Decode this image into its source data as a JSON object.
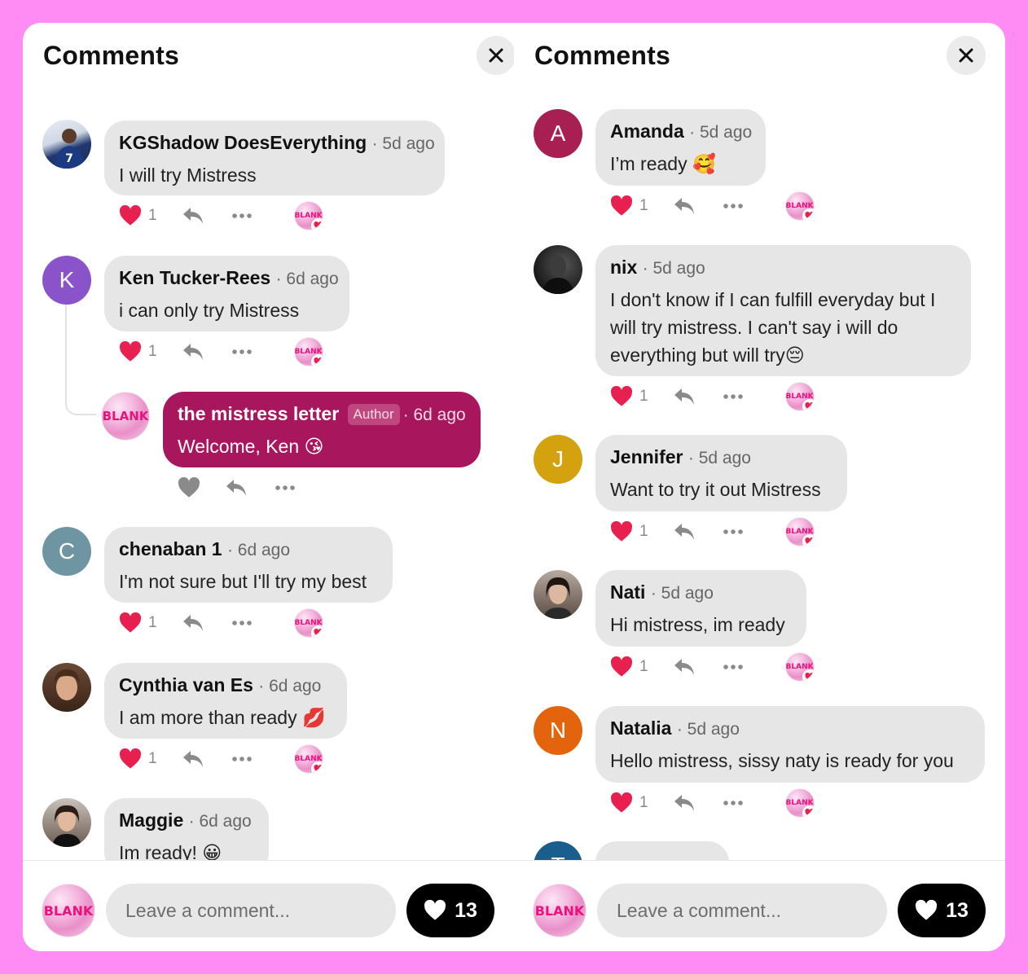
{
  "colors": {
    "background": "#ff8cf4",
    "like": "#e8204f",
    "author_bubble": "#a8175d",
    "avatar_K": "#8a53c9",
    "avatar_C": "#6f95a2",
    "avatar_A": "#a81f52",
    "avatar_J": "#d4a20f",
    "avatar_N": "#e3640d",
    "avatar_T": "#1a5e8e"
  },
  "left_panel": {
    "title": "Comments",
    "close_icon": "close-icon",
    "comments": [
      {
        "name": "KGShadow DoesEverything",
        "time": "· 5d ago",
        "text": "I will try Mistress",
        "likes": "1",
        "avatar": "photo"
      },
      {
        "name": "Ken Tucker-Rees",
        "time": "· 6d ago",
        "text": "i can only try Mistress",
        "likes": "1",
        "avatar_letter": "K"
      },
      {
        "name": "the mistress letter",
        "tag": "Author",
        "time": "· 6d ago",
        "text": "Welcome, Ken 😘",
        "avatar_text": "BLANK"
      },
      {
        "name": "chenaban 1",
        "time": "· 6d ago",
        "text": "I'm not sure but I'll try my best",
        "likes": "1",
        "avatar_letter": "C"
      },
      {
        "name": "Cynthia van Es",
        "time": "· 6d ago",
        "text": "I am more than ready 💋",
        "likes": "1",
        "avatar": "photo"
      },
      {
        "name": "Maggie",
        "time": "· 6d ago",
        "text": "Im ready! 😀",
        "avatar": "photo"
      }
    ],
    "footer": {
      "avatar_text": "BLANK",
      "placeholder": "Leave a comment...",
      "like_count": "13"
    }
  },
  "right_panel": {
    "title": "Comments",
    "close_icon": "close-icon",
    "comments": [
      {
        "name": "Amanda",
        "time": "· 5d ago",
        "text": "I’m ready 🥰",
        "likes": "1",
        "avatar_letter": "A"
      },
      {
        "name": "nix",
        "time": "· 5d ago",
        "text_lines": [
          "I don't know if I can fulfill everyday but I",
          "will try mistress. I can't say i will do",
          "everything but will try😔"
        ],
        "likes": "1",
        "avatar": "photo"
      },
      {
        "name": "Jennifer",
        "time": "· 5d ago",
        "text": "Want to try it out Mistress",
        "likes": "1",
        "avatar_letter": "J"
      },
      {
        "name": "Nati",
        "time": "· 5d ago",
        "text": "Hi mistress, im ready",
        "likes": "1",
        "avatar": "photo"
      },
      {
        "name": "Natalia",
        "time": "· 5d ago",
        "text": "Hello mistress, sissy naty is ready for you",
        "likes": "1",
        "avatar_letter": "N"
      },
      {
        "avatar_letter": "T"
      }
    ],
    "footer": {
      "avatar_text": "BLANK",
      "placeholder": "Leave a comment...",
      "like_count": "13"
    }
  }
}
